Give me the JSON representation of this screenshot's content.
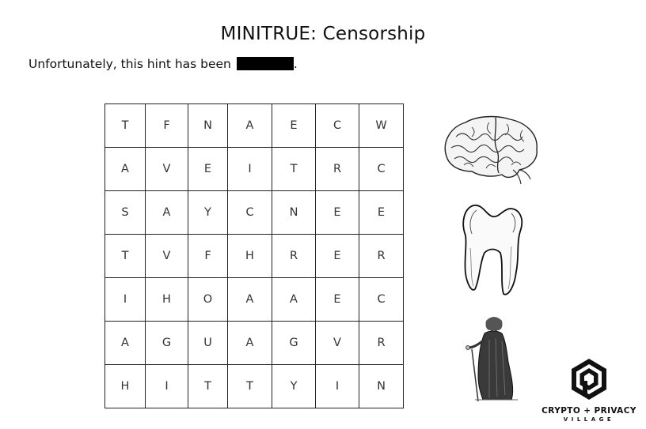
{
  "title": "MINITRUE: Censorship",
  "hint": {
    "text": "Unfortunately, this hint has been",
    "trailing": "."
  },
  "grid": {
    "rows": [
      [
        "T",
        "F",
        "N",
        "A",
        "E",
        "C",
        "W"
      ],
      [
        "A",
        "V",
        "E",
        "I",
        "T",
        "R",
        "C"
      ],
      [
        "S",
        "A",
        "Y",
        "C",
        "N",
        "E",
        "E"
      ],
      [
        "T",
        "V",
        "F",
        "H",
        "R",
        "E",
        "R"
      ],
      [
        "I",
        "H",
        "O",
        "A",
        "A",
        "E",
        "C"
      ],
      [
        "A",
        "G",
        "U",
        "A",
        "G",
        "V",
        "R"
      ],
      [
        "H",
        "I",
        "T",
        "T",
        "Y",
        "I",
        "N"
      ]
    ]
  },
  "images": [
    "brain-illustration",
    "tooth-illustration",
    "monk-illustration"
  ],
  "logo": {
    "line1": "CRYPTO + PRIVACY",
    "line2": "VILLAGE"
  }
}
